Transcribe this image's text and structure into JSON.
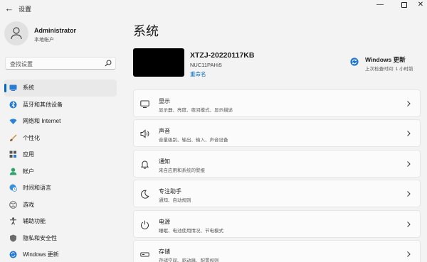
{
  "window": {
    "title": "设置",
    "back_glyph": "←",
    "minimize_glyph": "—",
    "close_glyph": "✕"
  },
  "account": {
    "name": "Administrator",
    "type": "本地帐户"
  },
  "search": {
    "placeholder": "查找设置",
    "icon": "search-icon"
  },
  "sidebar": {
    "items": [
      {
        "label": "系统",
        "icon": "system-icon",
        "active": true
      },
      {
        "label": "蓝牙和其他设备",
        "icon": "bluetooth-icon"
      },
      {
        "label": "网络和 Internet",
        "icon": "wifi-icon"
      },
      {
        "label": "个性化",
        "icon": "brush-icon"
      },
      {
        "label": "应用",
        "icon": "apps-icon"
      },
      {
        "label": "帐户",
        "icon": "person-icon"
      },
      {
        "label": "时间和语言",
        "icon": "globe-clock-icon"
      },
      {
        "label": "游戏",
        "icon": "xbox-icon"
      },
      {
        "label": "辅助功能",
        "icon": "accessibility-icon"
      },
      {
        "label": "隐私和安全性",
        "icon": "shield-icon"
      },
      {
        "label": "Windows 更新",
        "icon": "update-icon"
      }
    ]
  },
  "main": {
    "title": "系统",
    "device": {
      "name": "XTZJ-20220117KB",
      "model": "NUC11PAHi5",
      "rename_label": "重命名"
    },
    "update": {
      "title": "Windows 更新",
      "subtitle": "上次检查时间: 1 小时前"
    },
    "cards": [
      {
        "title": "显示",
        "subtitle": "显示器、亮度、夜间模式、显示描述",
        "icon": "monitor-icon"
      },
      {
        "title": "声音",
        "subtitle": "音量级别、输出、输入、声音设备",
        "icon": "speaker-icon"
      },
      {
        "title": "通知",
        "subtitle": "来自应用和系统的警报",
        "icon": "bell-icon"
      },
      {
        "title": "专注助手",
        "subtitle": "通知、自动规则",
        "icon": "moon-icon"
      },
      {
        "title": "电源",
        "subtitle": "睡眠、电池使用情况、节电模式",
        "icon": "power-icon"
      },
      {
        "title": "存储",
        "subtitle": "存储空间、驱动器、配置规则",
        "icon": "storage-icon"
      }
    ]
  },
  "colors": {
    "accent": "#0067c0",
    "background": "#f3f3f3",
    "card": "#fbfbfb"
  }
}
